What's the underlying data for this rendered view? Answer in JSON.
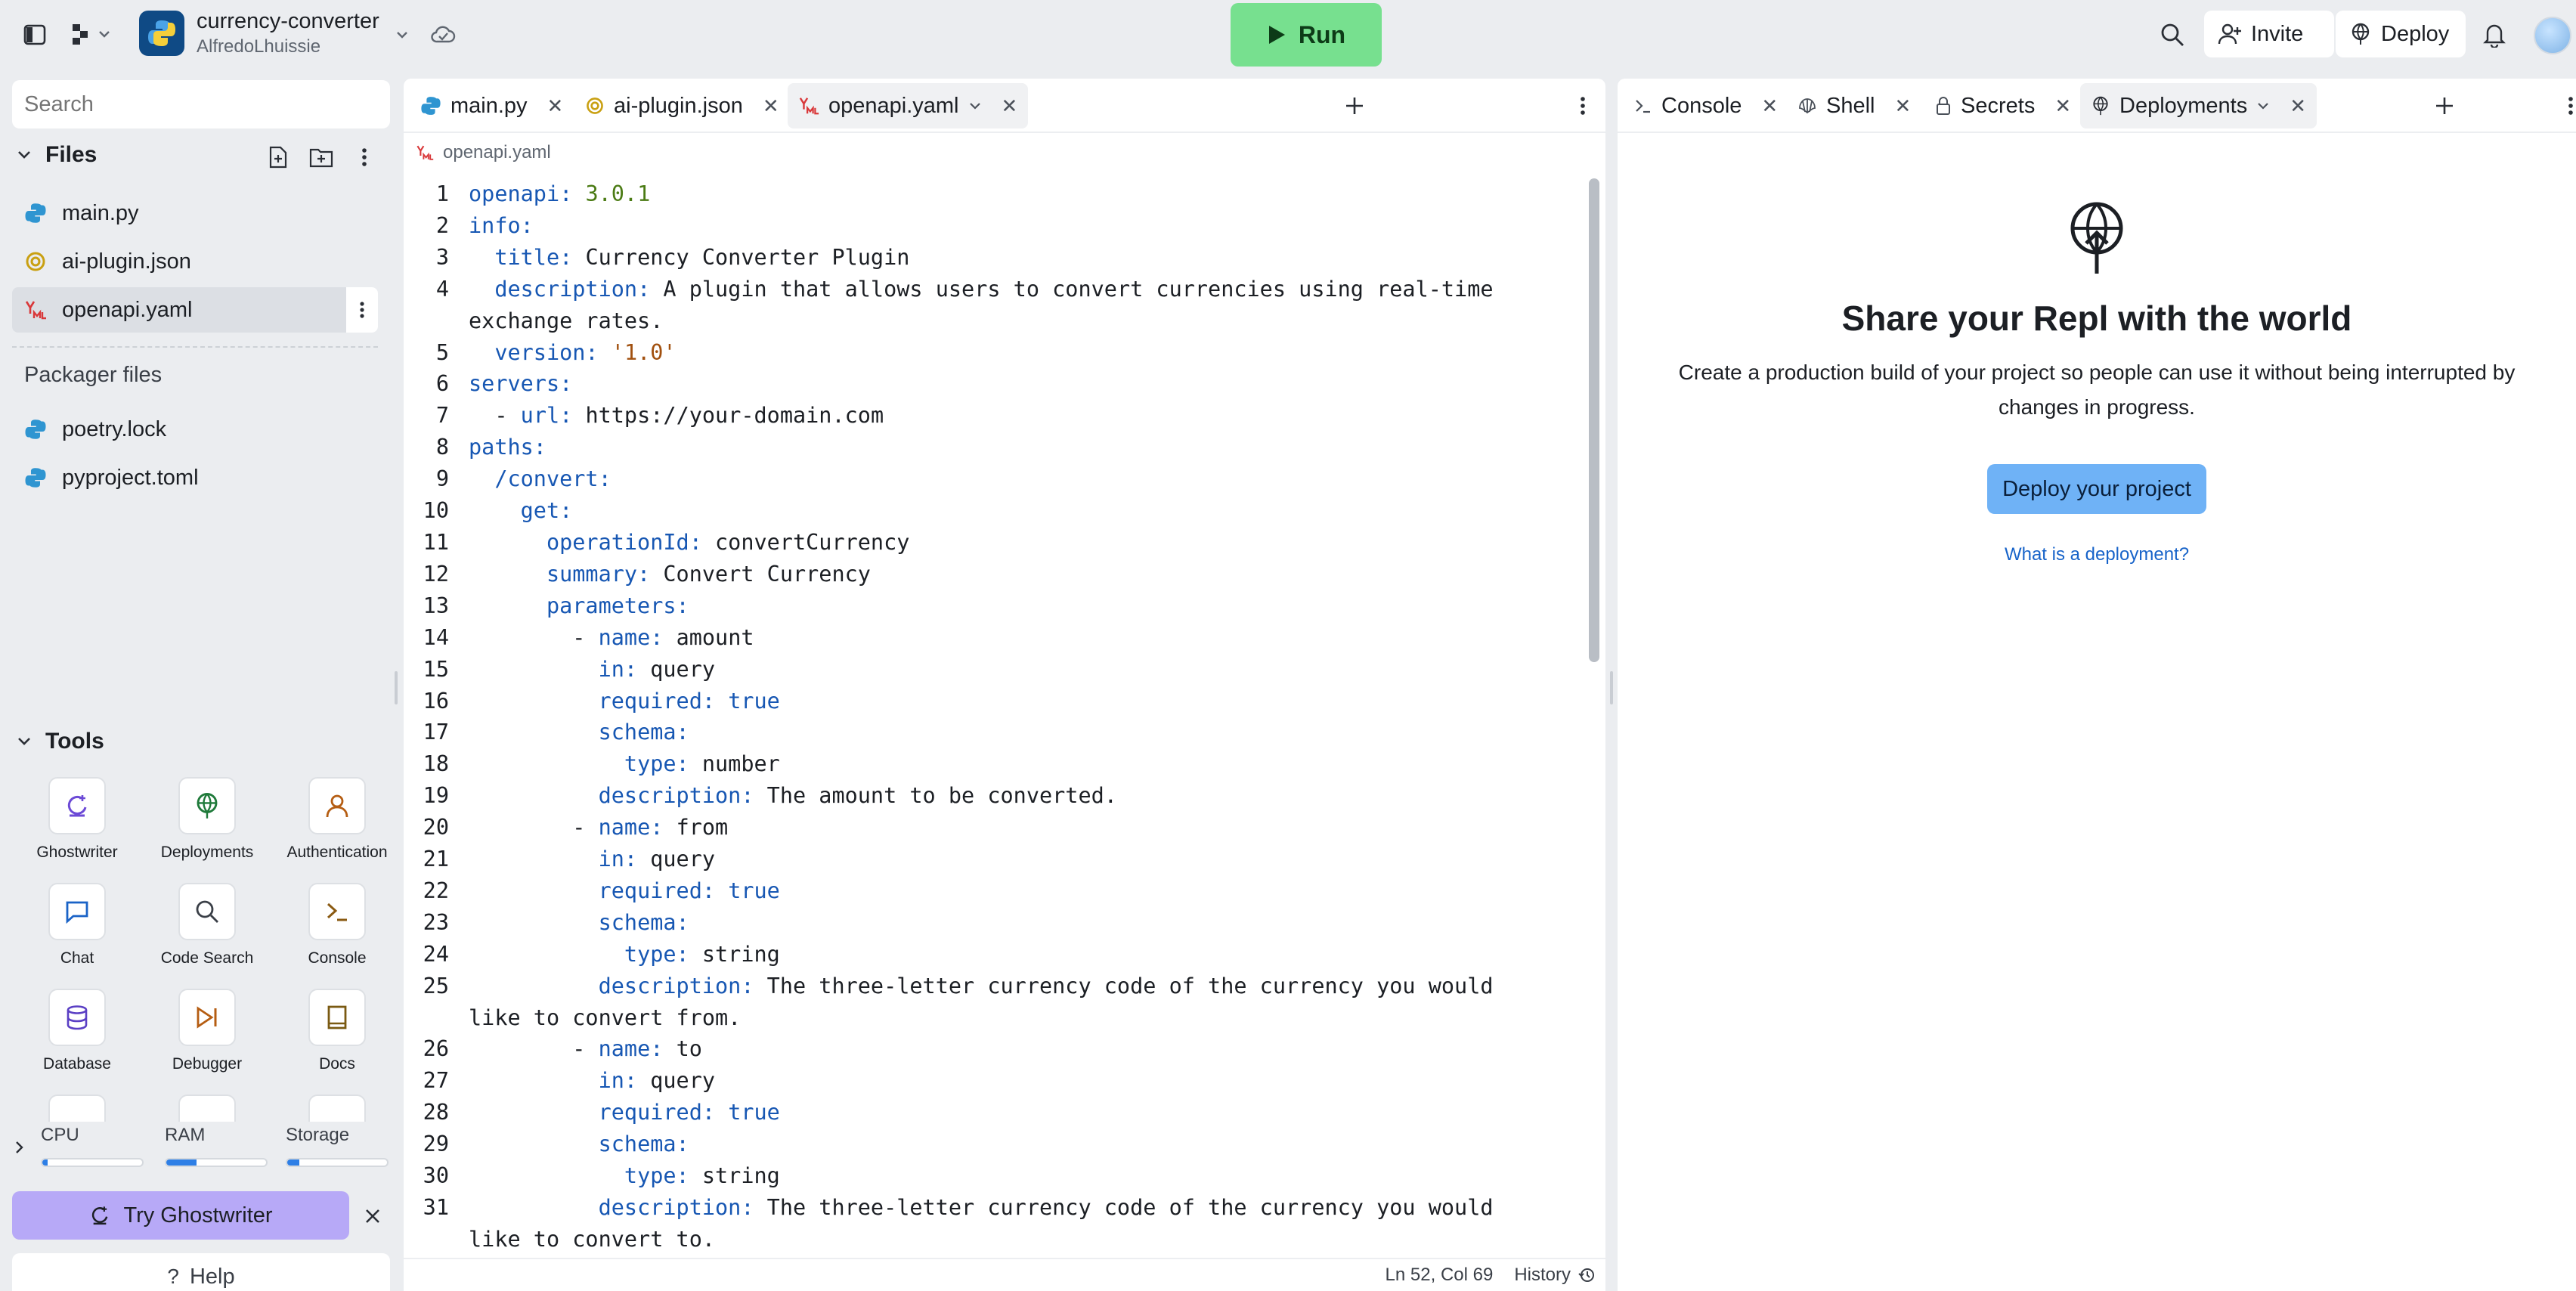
{
  "header": {
    "project_name": "currency-converter",
    "project_owner": "AlfredoLhuissie",
    "run_label": "Run",
    "invite_label": "Invite",
    "deploy_label": "Deploy"
  },
  "sidebar": {
    "search_placeholder": "Search",
    "files_heading": "Files",
    "files": [
      {
        "name": "main.py",
        "icon": "python-file-icon"
      },
      {
        "name": "ai-plugin.json",
        "icon": "json-file-icon"
      },
      {
        "name": "openapi.yaml",
        "icon": "yaml-file-icon"
      }
    ],
    "packager_heading": "Packager files",
    "packager_files": [
      {
        "name": "poetry.lock",
        "icon": "python-file-icon"
      },
      {
        "name": "pyproject.toml",
        "icon": "python-file-icon"
      }
    ],
    "tools_heading": "Tools",
    "tools": [
      {
        "label": "Ghostwriter",
        "icon": "ghostwriter-icon"
      },
      {
        "label": "Deployments",
        "icon": "deployments-icon"
      },
      {
        "label": "Authentication",
        "icon": "authentication-icon"
      },
      {
        "label": "Chat",
        "icon": "chat-icon"
      },
      {
        "label": "Code Search",
        "icon": "code-search-icon"
      },
      {
        "label": "Console",
        "icon": "console-icon"
      },
      {
        "label": "Database",
        "icon": "database-icon"
      },
      {
        "label": "Debugger",
        "icon": "debugger-icon"
      },
      {
        "label": "Docs",
        "icon": "docs-icon"
      }
    ],
    "resources": [
      {
        "label": "CPU",
        "level": 0.05
      },
      {
        "label": "RAM",
        "level": 0.3
      },
      {
        "label": "Storage",
        "level": 0.12
      }
    ],
    "try_ghostwriter_label": "Try Ghostwriter",
    "help_label": "Help"
  },
  "editor": {
    "tabs": [
      {
        "label": "main.py",
        "icon": "python-file-icon"
      },
      {
        "label": "ai-plugin.json",
        "icon": "json-file-icon"
      },
      {
        "label": "openapi.yaml",
        "icon": "yaml-file-icon"
      }
    ],
    "breadcrumb": "openapi.yaml",
    "cursor_position": "Ln 52, Col 69",
    "history_label": "History",
    "lines": [
      {
        "n": "1",
        "segs": [
          [
            "k",
            "openapi:"
          ],
          [
            "v",
            " "
          ],
          [
            "n",
            "3.0.1"
          ]
        ]
      },
      {
        "n": "2",
        "segs": [
          [
            "k",
            "info:"
          ]
        ]
      },
      {
        "n": "3",
        "segs": [
          [
            "v",
            "  "
          ],
          [
            "k",
            "title:"
          ],
          [
            "v",
            " Currency Converter Plugin"
          ]
        ]
      },
      {
        "n": "4",
        "segs": [
          [
            "v",
            "  "
          ],
          [
            "k",
            "description:"
          ],
          [
            "v",
            " A plugin that allows users to convert currencies using real-time exchange rates."
          ]
        ]
      },
      {
        "n": "5",
        "segs": [
          [
            "v",
            "  "
          ],
          [
            "k",
            "version:"
          ],
          [
            "v",
            " "
          ],
          [
            "s",
            "'1.0'"
          ]
        ]
      },
      {
        "n": "6",
        "segs": [
          [
            "k",
            "servers:"
          ]
        ]
      },
      {
        "n": "7",
        "segs": [
          [
            "v",
            "  - "
          ],
          [
            "k",
            "url:"
          ],
          [
            "v",
            " https://your-domain.com"
          ]
        ]
      },
      {
        "n": "8",
        "segs": [
          [
            "k",
            "paths:"
          ]
        ]
      },
      {
        "n": "9",
        "segs": [
          [
            "v",
            "  "
          ],
          [
            "k",
            "/convert:"
          ]
        ]
      },
      {
        "n": "10",
        "segs": [
          [
            "v",
            "    "
          ],
          [
            "k",
            "get:"
          ]
        ]
      },
      {
        "n": "11",
        "segs": [
          [
            "v",
            "      "
          ],
          [
            "k",
            "operationId:"
          ],
          [
            "v",
            " convertCurrency"
          ]
        ]
      },
      {
        "n": "12",
        "segs": [
          [
            "v",
            "      "
          ],
          [
            "k",
            "summary:"
          ],
          [
            "v",
            " Convert Currency"
          ]
        ]
      },
      {
        "n": "13",
        "segs": [
          [
            "v",
            "      "
          ],
          [
            "k",
            "parameters:"
          ]
        ]
      },
      {
        "n": "14",
        "segs": [
          [
            "v",
            "        - "
          ],
          [
            "k",
            "name:"
          ],
          [
            "v",
            " amount"
          ]
        ]
      },
      {
        "n": "15",
        "segs": [
          [
            "v",
            "          "
          ],
          [
            "k",
            "in:"
          ],
          [
            "v",
            " query"
          ]
        ]
      },
      {
        "n": "16",
        "segs": [
          [
            "v",
            "          "
          ],
          [
            "k",
            "required:"
          ],
          [
            "v",
            " "
          ],
          [
            "k",
            "true"
          ]
        ]
      },
      {
        "n": "17",
        "segs": [
          [
            "v",
            "          "
          ],
          [
            "k",
            "schema:"
          ]
        ]
      },
      {
        "n": "18",
        "segs": [
          [
            "v",
            "            "
          ],
          [
            "k",
            "type:"
          ],
          [
            "v",
            " number"
          ]
        ]
      },
      {
        "n": "19",
        "segs": [
          [
            "v",
            "          "
          ],
          [
            "k",
            "description:"
          ],
          [
            "v",
            " The amount to be converted."
          ]
        ]
      },
      {
        "n": "20",
        "segs": [
          [
            "v",
            "        - "
          ],
          [
            "k",
            "name:"
          ],
          [
            "v",
            " from"
          ]
        ]
      },
      {
        "n": "21",
        "segs": [
          [
            "v",
            "          "
          ],
          [
            "k",
            "in:"
          ],
          [
            "v",
            " query"
          ]
        ]
      },
      {
        "n": "22",
        "segs": [
          [
            "v",
            "          "
          ],
          [
            "k",
            "required:"
          ],
          [
            "v",
            " "
          ],
          [
            "k",
            "true"
          ]
        ]
      },
      {
        "n": "23",
        "segs": [
          [
            "v",
            "          "
          ],
          [
            "k",
            "schema:"
          ]
        ]
      },
      {
        "n": "24",
        "segs": [
          [
            "v",
            "            "
          ],
          [
            "k",
            "type:"
          ],
          [
            "v",
            " string"
          ]
        ]
      },
      {
        "n": "25",
        "segs": [
          [
            "v",
            "          "
          ],
          [
            "k",
            "description:"
          ],
          [
            "v",
            " The three-letter currency code of the currency you would like to convert from."
          ]
        ]
      },
      {
        "n": "26",
        "segs": [
          [
            "v",
            "        - "
          ],
          [
            "k",
            "name:"
          ],
          [
            "v",
            " to"
          ]
        ]
      },
      {
        "n": "27",
        "segs": [
          [
            "v",
            "          "
          ],
          [
            "k",
            "in:"
          ],
          [
            "v",
            " query"
          ]
        ]
      },
      {
        "n": "28",
        "segs": [
          [
            "v",
            "          "
          ],
          [
            "k",
            "required:"
          ],
          [
            "v",
            " "
          ],
          [
            "k",
            "true"
          ]
        ]
      },
      {
        "n": "29",
        "segs": [
          [
            "v",
            "          "
          ],
          [
            "k",
            "schema:"
          ]
        ]
      },
      {
        "n": "30",
        "segs": [
          [
            "v",
            "            "
          ],
          [
            "k",
            "type:"
          ],
          [
            "v",
            " string"
          ]
        ]
      },
      {
        "n": "31",
        "segs": [
          [
            "v",
            "          "
          ],
          [
            "k",
            "description:"
          ],
          [
            "v",
            " The three-letter currency code of the currency you would like to convert to."
          ]
        ]
      }
    ]
  },
  "right_pane": {
    "tabs": [
      {
        "label": "Console",
        "icon": "console-icon"
      },
      {
        "label": "Shell",
        "icon": "shell-icon"
      },
      {
        "label": "Secrets",
        "icon": "lock-icon"
      },
      {
        "label": "Deployments",
        "icon": "deployments-icon"
      }
    ],
    "title": "Share your Repl with the world",
    "description": "Create a production build of your project so people can use it without being interrupted by changes in progress.",
    "deploy_button_label": "Deploy your project",
    "help_link": "What is a deployment?"
  },
  "colors": {
    "run_green": "#77e08f",
    "yaml_key": "#1757b3",
    "yaml_number": "#4b7b14",
    "yaml_string": "#a1500f",
    "deploy_blue": "#6fb2f6",
    "ghostwriter_purple": "#b7a9f7"
  }
}
